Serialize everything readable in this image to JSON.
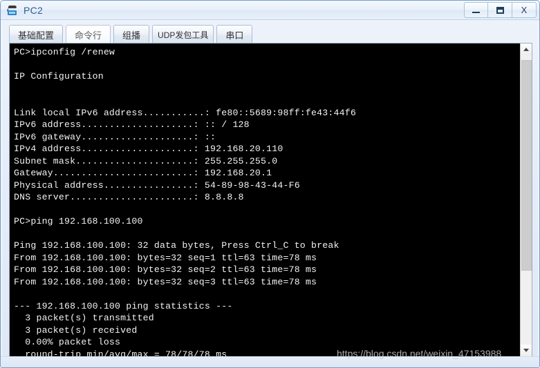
{
  "window": {
    "title": "PC2",
    "icon": "computer-icon",
    "controls": {
      "minimize": "—",
      "maximize": "❐",
      "close": "X"
    }
  },
  "tabs": [
    {
      "label": "基础配置",
      "selected": false
    },
    {
      "label": "命令行",
      "selected": true
    },
    {
      "label": "组播",
      "selected": false
    },
    {
      "label": "UDP发包工具",
      "selected": false
    },
    {
      "label": "串口",
      "selected": false
    }
  ],
  "terminal": {
    "prompt": "PC>",
    "lines": [
      "PC>ipconfig /renew",
      "",
      "IP Configuration",
      "",
      "",
      "Link local IPv6 address...........: fe80::5689:98ff:fe43:44f6",
      "IPv6 address....................: :: / 128",
      "IPv6 gateway....................: ::",
      "IPv4 address....................: 192.168.20.110",
      "Subnet mask.....................: 255.255.255.0",
      "Gateway.........................: 192.168.20.1",
      "Physical address................: 54-89-98-43-44-F6",
      "DNS server......................: 8.8.8.8",
      "",
      "PC>ping 192.168.100.100",
      "",
      "Ping 192.168.100.100: 32 data bytes, Press Ctrl_C to break",
      "From 192.168.100.100: bytes=32 seq=1 ttl=63 time=78 ms",
      "From 192.168.100.100: bytes=32 seq=2 ttl=63 time=78 ms",
      "From 192.168.100.100: bytes=32 seq=3 ttl=63 time=78 ms",
      "",
      "--- 192.168.100.100 ping statistics ---",
      "  3 packet(s) transmitted",
      "  3 packet(s) received",
      "  0.00% packet loss",
      "  round-trip min/avg/max = 78/78/78 ms"
    ],
    "commands": [
      "ipconfig /renew",
      "ping 192.168.100.100"
    ],
    "ip_configuration": {
      "heading": "IP Configuration",
      "link_local_ipv6_address": "fe80::5689:98ff:fe43:44f6",
      "ipv6_address": ":: / 128",
      "ipv6_gateway": "::",
      "ipv4_address": "192.168.20.110",
      "subnet_mask": "255.255.255.0",
      "gateway": "192.168.20.1",
      "physical_address": "54-89-98-43-44-F6",
      "dns_server": "8.8.8.8"
    },
    "ping_result": {
      "target": "192.168.100.100",
      "data_bytes": "32",
      "break_hint": "Press Ctrl_C to break",
      "replies": [
        {
          "seq": "1",
          "bytes": "32",
          "ttl": "63",
          "time": "78 ms"
        },
        {
          "seq": "2",
          "bytes": "32",
          "ttl": "63",
          "time": "78 ms"
        },
        {
          "seq": "3",
          "bytes": "32",
          "ttl": "63",
          "time": "78 ms"
        }
      ],
      "statistics_header": "--- 192.168.100.100 ping statistics ---",
      "transmitted": "3 packet(s) transmitted",
      "received": "3 packet(s) received",
      "packet_loss": "0.00% packet loss"
    }
  },
  "scrollbar": {
    "up_arrow": "scroll-up",
    "down_arrow": "scroll-down"
  },
  "watermark": "https://blog.csdn.net/weixin_47153988",
  "colors": {
    "terminal_bg": "#000000",
    "terminal_fg": "#f2f2f2",
    "title_text": "#2b5f92",
    "chrome": "#e6edf8"
  }
}
